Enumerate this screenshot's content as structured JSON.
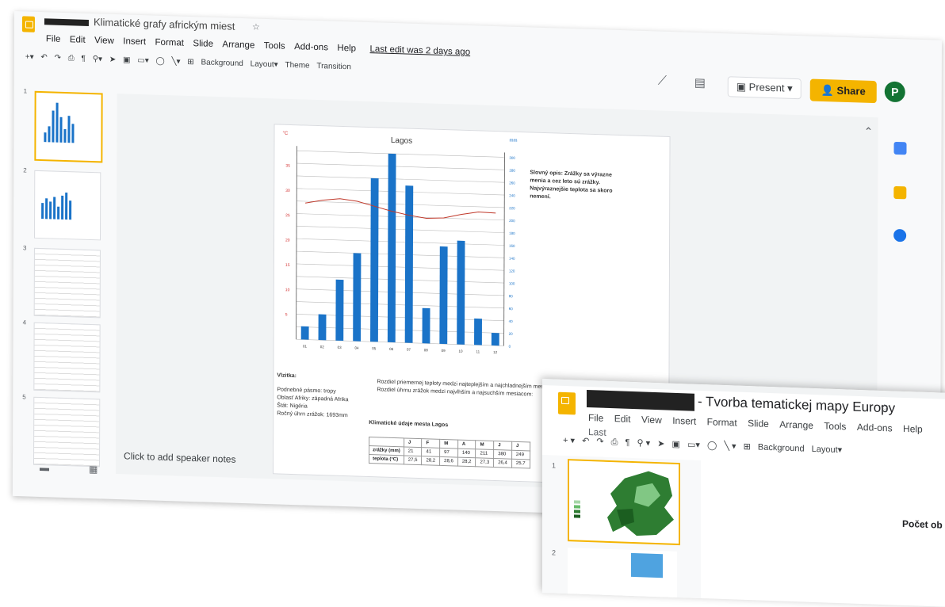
{
  "main": {
    "title": "Klimatické grafy africkým miest",
    "menu": [
      "File",
      "Edit",
      "View",
      "Insert",
      "Format",
      "Slide",
      "Arrange",
      "Tools",
      "Add-ons",
      "Help"
    ],
    "last_edit": "Last edit was 2 days ago",
    "toolbar": {
      "background": "Background",
      "layout": "Layout▾",
      "theme": "Theme",
      "transition": "Transition"
    },
    "present": "Present",
    "share": "Share",
    "avatar": "P",
    "speaker_notes": "Click to add speaker notes",
    "slide_numbers": [
      "1",
      "2",
      "3",
      "4",
      "5"
    ]
  },
  "slide": {
    "chart_title": "Lagos",
    "left_unit": "°C",
    "right_unit": "mm",
    "description": [
      "Slovný opis: Zrážky sa výrazne",
      "menia a cez leto sú zrážky.",
      "Najvýraznejšie teplota sa skoro",
      "nemení."
    ],
    "hints_title": "Vlzitka:",
    "hints": [
      "Podnebné pásmo: tropy",
      "Oblasť Afriky: západná Afrika",
      "Štát: Nigéria",
      "Ročný úhrn zrážok: 1693mm"
    ],
    "differences": [
      "Rozdiel priemernej teploty medzi najteplejším a najchladnejším mesiacom:",
      "Rozdiel úhrnu zrážok medzi najvlhším a najsuchším mesiacom:"
    ],
    "table_title": "Klimatické údaje mesta Lagos",
    "table_headers": [
      "",
      "J",
      "F",
      "M",
      "A",
      "M",
      "J",
      "J"
    ],
    "table_rows": [
      {
        "label": "zrážky (mm)",
        "values": [
          "21",
          "41",
          "97",
          "140",
          "211",
          "380",
          "249"
        ]
      },
      {
        "label": "teplota (°C)",
        "values": [
          "27,5",
          "28,2",
          "28,6",
          "28,2",
          "27,3",
          "26,4",
          "25,7"
        ]
      }
    ]
  },
  "chart_data": {
    "type": "bar",
    "title": "Lagos",
    "categories": [
      "01",
      "02",
      "03",
      "04",
      "05",
      "06",
      "07",
      "08",
      "09",
      "10",
      "11",
      "12"
    ],
    "series": [
      {
        "name": "zrážky",
        "values": [
          21,
          41,
          97,
          140,
          260,
          300,
          250,
          56,
          155,
          165,
          42,
          20
        ],
        "axis": "right"
      },
      {
        "name": "teplota",
        "values": [
          27.5,
          28.2,
          28.6,
          28.2,
          27.3,
          26.4,
          25.7,
          25.2,
          25.4,
          26.2,
          26.8,
          26.7
        ],
        "axis": "left",
        "type": "line"
      }
    ],
    "left_ticks": [
      "35",
      "30",
      "25",
      "20",
      "15",
      "10",
      "5"
    ],
    "right_ticks": [
      "300",
      "280",
      "260",
      "240",
      "220",
      "200",
      "180",
      "160",
      "140",
      "120",
      "100",
      "80",
      "60",
      "40",
      "20",
      "0"
    ],
    "ylim_left": [
      0,
      38
    ],
    "ylim_right": [
      0,
      300
    ],
    "colors": {
      "bars": "#1a73c8",
      "line": "#c0392b"
    }
  },
  "second": {
    "title": "- Tvorba tematickej mapy Europy",
    "menu": [
      "File",
      "Edit",
      "View",
      "Insert",
      "Format",
      "Slide",
      "Arrange",
      "Tools",
      "Add-ons",
      "Help"
    ],
    "last": "Last",
    "toolbar": {
      "background": "Background",
      "layout": "Layout▾"
    },
    "slide_heading": "Počet ob",
    "slide_numbers": [
      "1",
      "2"
    ]
  }
}
